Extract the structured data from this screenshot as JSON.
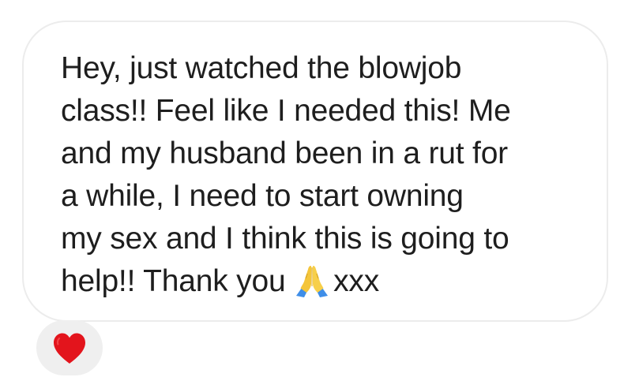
{
  "message": {
    "lines": [
      "Hey, just watched the blowjob",
      "class!!  Feel like I needed this! Me",
      "and my husband been in a rut for",
      "a while, I need to start owning",
      "my sex and I think this is going to"
    ],
    "last_line_prefix": "help!! Thank you ",
    "last_line_suffix": "xxx",
    "emoji_icon": "folded-hands-icon"
  },
  "reaction": {
    "icon": "red-heart-icon",
    "color": "#e3141c"
  },
  "colors": {
    "bubble_border": "#ececec",
    "text": "#1e1e1e",
    "reaction_bg": "#efefef"
  }
}
